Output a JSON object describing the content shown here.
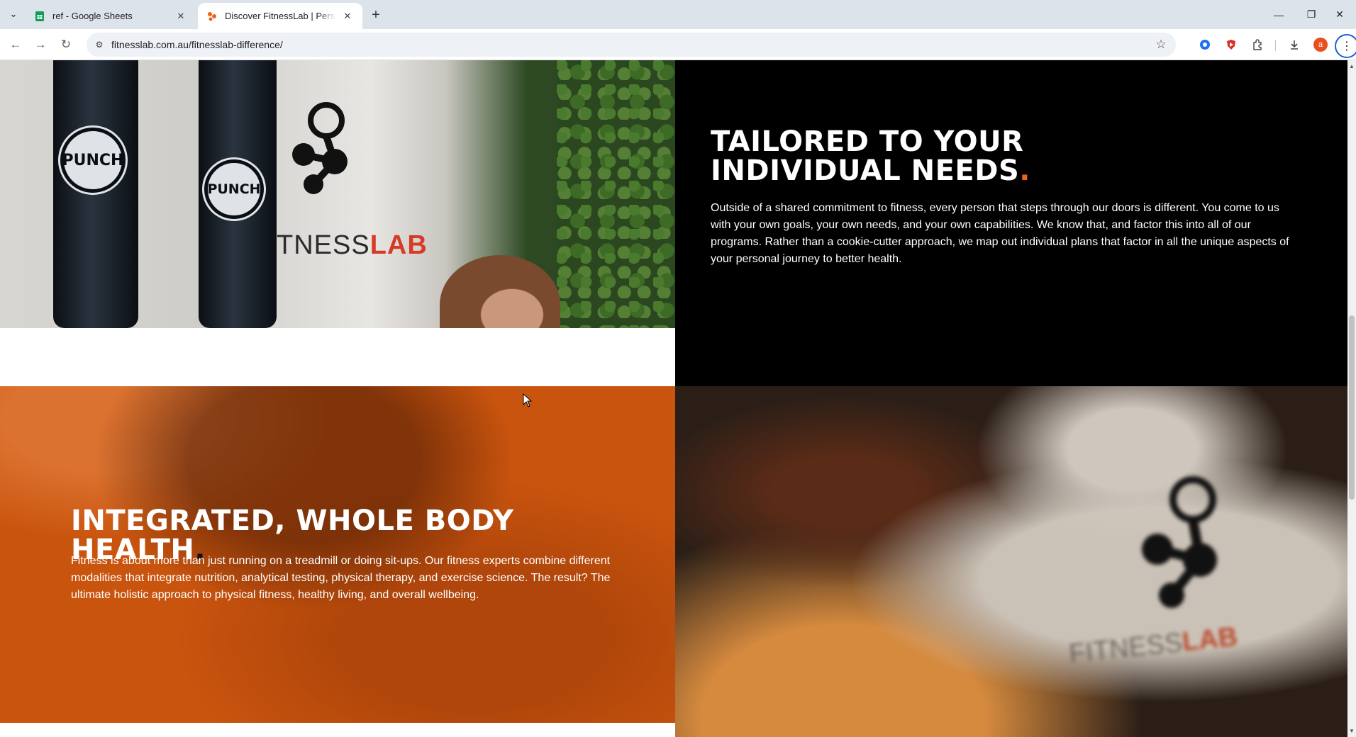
{
  "browser": {
    "tabs": [
      {
        "title": "ref - Google Sheets",
        "active": false
      },
      {
        "title": "Discover FitnessLab | Personal Training",
        "active": true
      }
    ],
    "url": "fitnesslab.com.au/fitnesslab-difference/",
    "profile_initial": "a"
  },
  "gym_photo": {
    "bag_badge_text": "PUNCH",
    "wall_text_prefix": "TNESS",
    "wall_text_suffix": "LAB"
  },
  "sections": [
    {
      "title": "TAILORED TO YOUR INDIVIDUAL NEEDS",
      "title_dot": ".",
      "body": "Outside of a shared commitment to fitness, every person that steps through our doors is different. You come to us with your own goals, your own needs, and your own capabilities. We know that, and factor this into all of our programs. Rather than a cookie-cutter approach, we map out individual plans that factor in all the unique aspects of your personal journey to better health."
    },
    {
      "title": "INTEGRATED, WHOLE BODY HEALTH",
      "title_dot": ".",
      "body": "Fitness is about more than just running on a treadmill or doing sit-ups. Our fitness experts combine different modalities that integrate nutrition, analytical testing, physical therapy, and exercise science. The result? The ultimate holistic approach to physical fitness, healthy living, and overall wellbeing."
    }
  ],
  "blur_photo": {
    "text_prefix": "FITNESS",
    "text_suffix": "LAB"
  },
  "colors": {
    "accent_orange": "#e8661c",
    "panel_orange": "#c9540e",
    "panel_black": "#000000"
  }
}
